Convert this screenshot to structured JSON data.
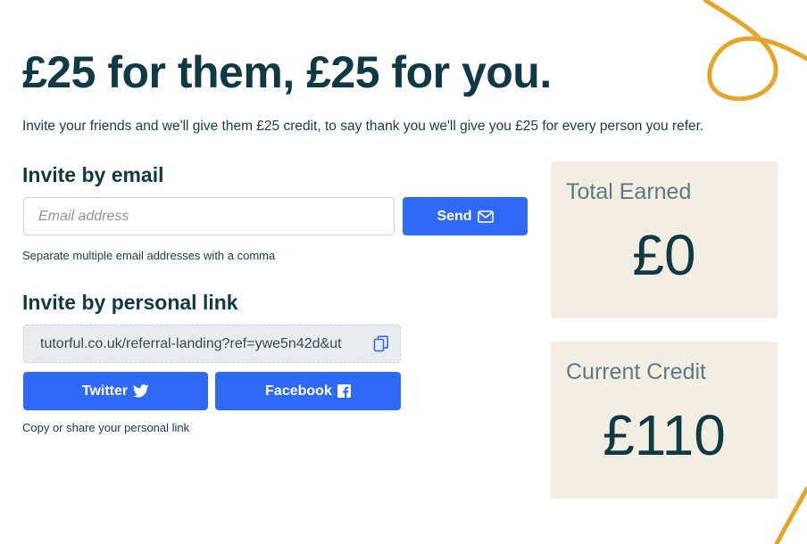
{
  "headline": "£25 for them, £25 for you.",
  "intro": "Invite your friends and we'll give them £25 credit, to say thank you we'll give you £25 for every person you refer.",
  "email_section": {
    "title": "Invite by email",
    "placeholder": "Email address",
    "send_label": "Send",
    "hint": "Separate multiple email addresses with a comma"
  },
  "link_section": {
    "title": "Invite by personal link",
    "link": "tutorful.co.uk/referral-landing?ref=ywe5n42d&ut",
    "twitter_label": "Twitter",
    "facebook_label": "Facebook",
    "hint": "Copy or share your personal link"
  },
  "stats": {
    "total_earned_label": "Total Earned",
    "total_earned_value": "£0",
    "current_credit_label": "Current Credit",
    "current_credit_value": "£110"
  },
  "icons": {
    "send": "envelope-icon",
    "copy": "copy-icon",
    "twitter": "twitter-bird-icon",
    "facebook": "facebook-icon"
  },
  "colors": {
    "accent": "#2f6af7",
    "heading": "#0f3a44",
    "card": "#f3eee3",
    "doodle": "#e3a62a"
  }
}
